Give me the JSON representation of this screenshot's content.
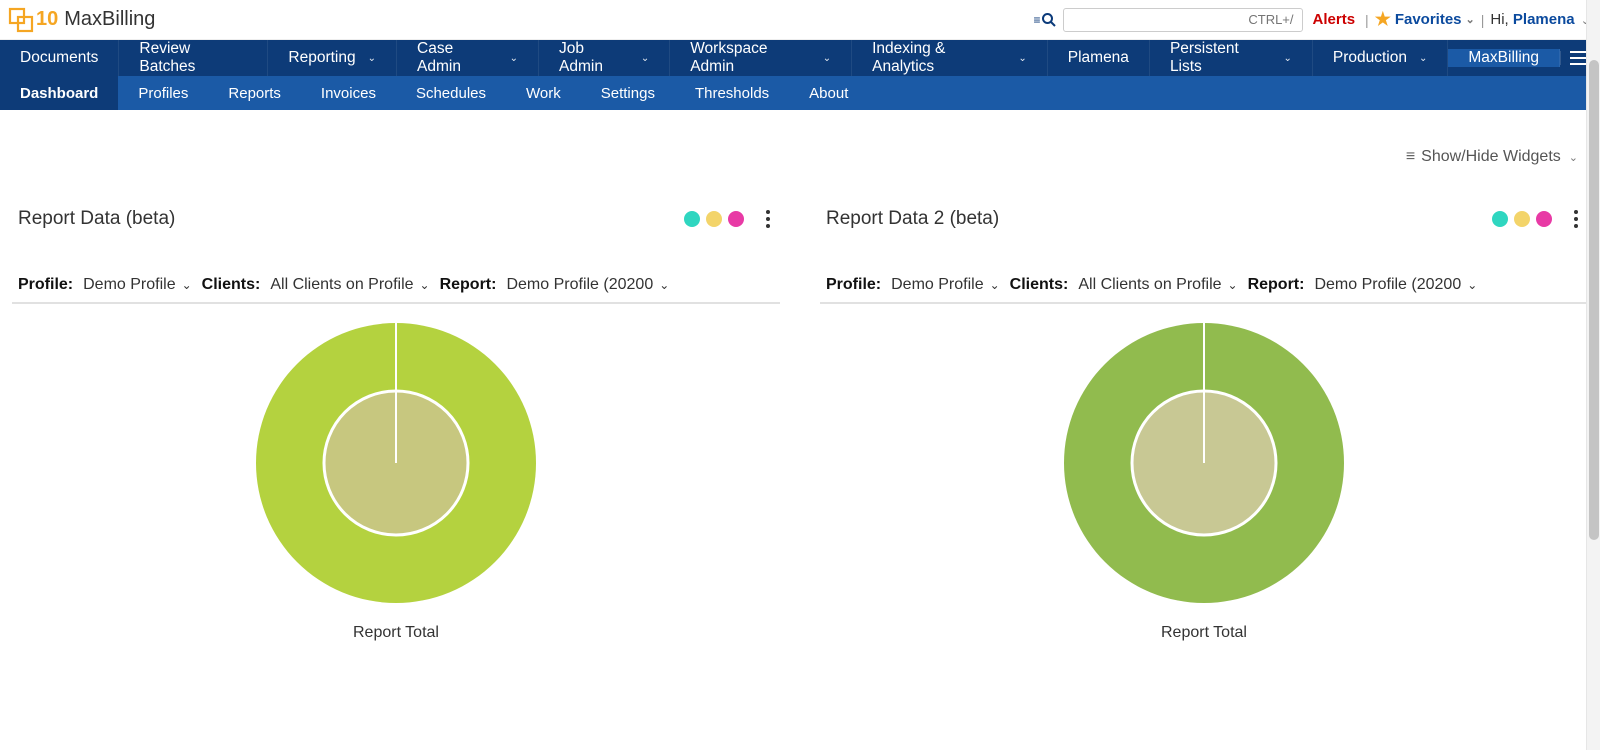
{
  "header": {
    "logo_number": "10",
    "app_name": "MaxBilling",
    "search_placeholder": "CTRL+/",
    "alerts_label": "Alerts",
    "favorites_label": "Favorites",
    "greeting_prefix": "Hi,",
    "user_name": "Plamena"
  },
  "primary_nav": {
    "items": [
      {
        "label": "Documents",
        "dropdown": false
      },
      {
        "label": "Review Batches",
        "dropdown": false
      },
      {
        "label": "Reporting",
        "dropdown": true
      },
      {
        "label": "Case Admin",
        "dropdown": true
      },
      {
        "label": "Job Admin",
        "dropdown": true
      },
      {
        "label": "Workspace Admin",
        "dropdown": true
      },
      {
        "label": "Indexing & Analytics",
        "dropdown": true
      },
      {
        "label": "Plamena",
        "dropdown": false
      },
      {
        "label": "Persistent Lists",
        "dropdown": true
      },
      {
        "label": "Production",
        "dropdown": true
      }
    ],
    "active_right": "MaxBilling"
  },
  "secondary_nav": {
    "items": [
      "Dashboard",
      "Profiles",
      "Reports",
      "Invoices",
      "Schedules",
      "Work",
      "Settings",
      "Thresholds",
      "About"
    ],
    "active_index": 0
  },
  "widget_toggle_label": "Show/Hide Widgets",
  "widgets": [
    {
      "title": "Report Data (beta)",
      "filters": {
        "profile_label": "Profile:",
        "profile_value": "Demo Profile",
        "clients_label": "Clients:",
        "clients_value": "All Clients on Profile",
        "report_label": "Report:",
        "report_value": "Demo Profile (20200"
      },
      "chart_caption": "Report Total",
      "chart_colors": {
        "outer": "#b4d23f",
        "inner": "#c7c77f"
      }
    },
    {
      "title": "Report Data 2 (beta)",
      "filters": {
        "profile_label": "Profile:",
        "profile_value": "Demo Profile",
        "clients_label": "Clients:",
        "clients_value": "All Clients on Profile",
        "report_label": "Report:",
        "report_value": "Demo Profile (20200"
      },
      "chart_caption": "Report Total",
      "chart_colors": {
        "outer": "#91bb4e",
        "inner": "#c8c894"
      }
    }
  ],
  "chart_data": [
    {
      "type": "pie",
      "title": "Report Total",
      "series": [
        {
          "name": "outer_ring",
          "slices": [
            {
              "label": "total",
              "value": 100
            }
          ]
        },
        {
          "name": "inner_ring",
          "slices": [
            {
              "label": "total",
              "value": 100
            }
          ]
        }
      ]
    },
    {
      "type": "pie",
      "title": "Report Total",
      "series": [
        {
          "name": "outer_ring",
          "slices": [
            {
              "label": "total",
              "value": 100
            }
          ]
        },
        {
          "name": "inner_ring",
          "slices": [
            {
              "label": "total",
              "value": 100
            }
          ]
        }
      ]
    }
  ]
}
